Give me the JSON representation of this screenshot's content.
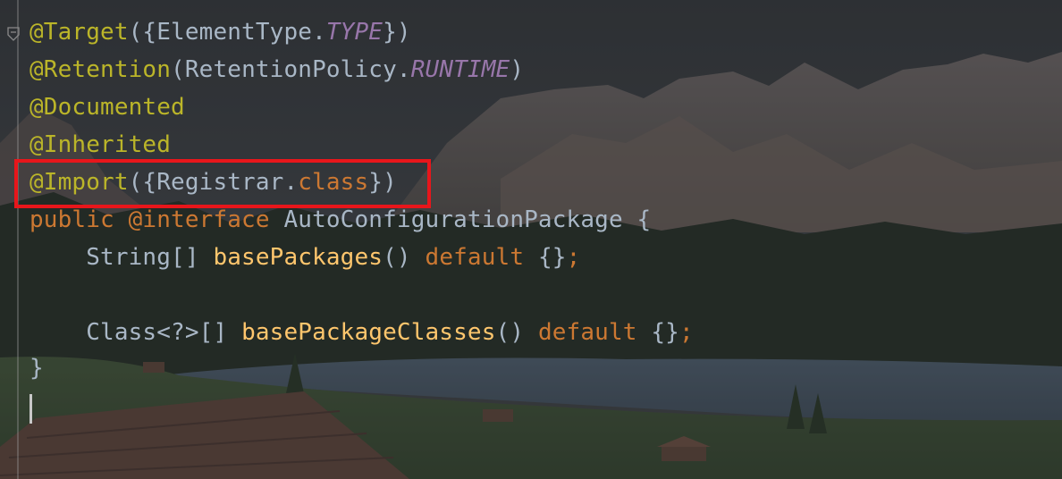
{
  "editor": {
    "lines": [
      {
        "tokens": [
          [
            "@Target",
            "ann"
          ],
          [
            "({ElementType.",
            "plain"
          ],
          [
            "TYPE",
            "ital"
          ],
          [
            "})",
            "plain"
          ]
        ]
      },
      {
        "tokens": [
          [
            "@Retention",
            "ann"
          ],
          [
            "(RetentionPolicy.",
            "plain"
          ],
          [
            "RUNTIME",
            "ital"
          ],
          [
            ")",
            "plain"
          ]
        ]
      },
      {
        "tokens": [
          [
            "@Documented",
            "ann"
          ]
        ]
      },
      {
        "tokens": [
          [
            "@Inherited",
            "ann"
          ]
        ]
      },
      {
        "tokens": [
          [
            "@Import",
            "ann"
          ],
          [
            "({Registrar.",
            "plain"
          ],
          [
            "class",
            "kw"
          ],
          [
            "})",
            "plain"
          ]
        ]
      },
      {
        "tokens": [
          [
            "public ",
            "kw"
          ],
          [
            "@interface ",
            "kw"
          ],
          [
            "AutoConfigurationPackage {",
            "plain"
          ]
        ]
      },
      {
        "tokens": [
          [
            "    String[] ",
            "plain"
          ],
          [
            "basePackages",
            "fn"
          ],
          [
            "() ",
            "plain"
          ],
          [
            "default",
            "kw"
          ],
          [
            " {}",
            "plain"
          ],
          [
            ";",
            "kw"
          ]
        ]
      },
      {
        "tokens": [
          [
            "",
            "plain"
          ]
        ]
      },
      {
        "tokens": [
          [
            "    Class<?>[] ",
            "plain"
          ],
          [
            "basePackageClasses",
            "fn"
          ],
          [
            "() ",
            "plain"
          ],
          [
            "default",
            "kw"
          ],
          [
            " {}",
            "plain"
          ],
          [
            ";",
            "kw"
          ]
        ]
      },
      {
        "tokens": [
          [
            "}",
            "plain"
          ]
        ]
      }
    ],
    "highlight_color": "#e8161b",
    "colors": {
      "annotation": "#bbb529",
      "text": "#a9b7c6",
      "constant": "#9876aa",
      "keyword": "#cc7832",
      "method": "#ffc66d"
    }
  }
}
